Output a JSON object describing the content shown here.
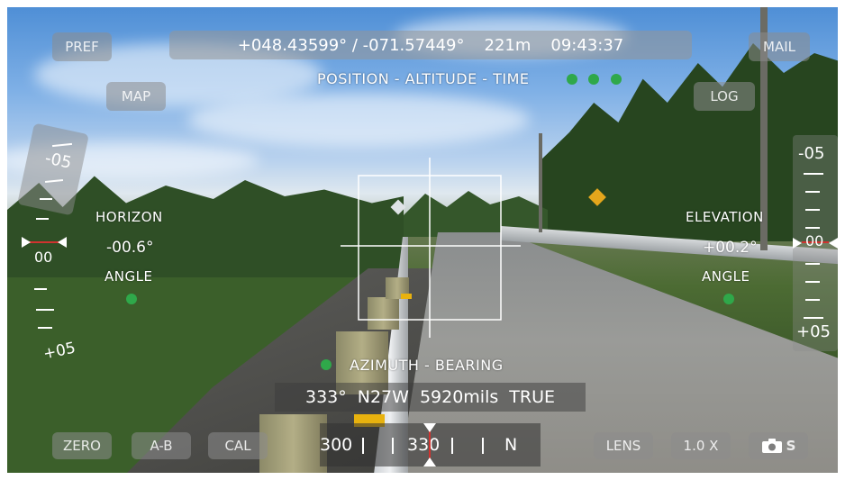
{
  "status": {
    "position": "+048.43599° / -071.57449°",
    "altitude": "221m",
    "time": "09:43:37",
    "caption": "POSITION - ALTITUDE - TIME"
  },
  "buttons": {
    "pref": "PREF",
    "map": "MAP",
    "mail": "MAIL",
    "log": "LOG",
    "zero": "ZERO",
    "ab": "A-B",
    "cal": "CAL",
    "lens": "LENS",
    "zoom": "1.0 X",
    "camera_suffix": "S"
  },
  "horizon": {
    "label": "HORIZON",
    "value": "-00.6°",
    "sub": "ANGLE",
    "scale_top": "-05",
    "scale_mid": "00",
    "scale_bottom": "+05"
  },
  "elevation": {
    "label": "ELEVATION",
    "value": "+00.2°",
    "sub": "ANGLE",
    "scale_top": "-05",
    "scale_mid": "00",
    "scale_bottom": "+05"
  },
  "azimuth": {
    "caption": "AZIMUTH - BEARING",
    "degrees": "333°",
    "direction": "N27W",
    "mils": "5920mils",
    "reference": "TRUE"
  },
  "compass": {
    "left": "300",
    "center": "330",
    "right": "N"
  },
  "colors": {
    "indicator_green": "#2fa84a",
    "marker_red": "#d0332f"
  }
}
